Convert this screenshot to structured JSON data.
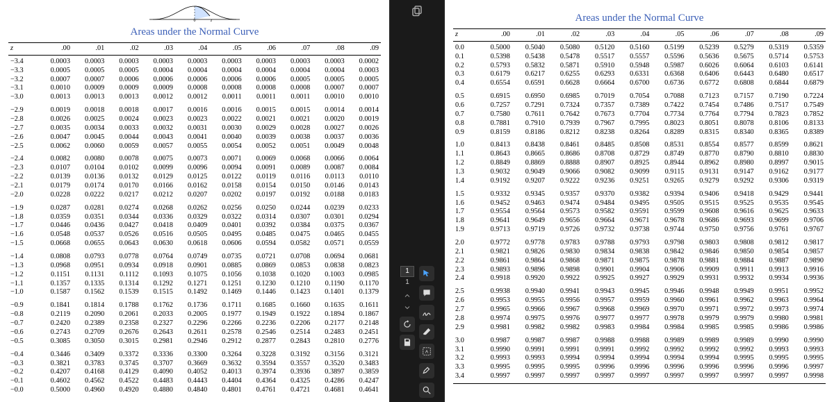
{
  "title": "Areas under the Normal Curve",
  "curve_labels": {
    "zero": "0",
    "z": "z"
  },
  "col_headers": [
    "z",
    ".00",
    ".01",
    ".02",
    ".03",
    ".04",
    ".05",
    ".06",
    ".07",
    ".08",
    ".09"
  ],
  "toolbar": {
    "page_current": "1",
    "page_total": "1"
  },
  "left_table": [
    [
      [
        "−3.4",
        "0.0003",
        "0.0003",
        "0.0003",
        "0.0003",
        "0.0003",
        "0.0003",
        "0.0003",
        "0.0003",
        "0.0003",
        "0.0002"
      ],
      [
        "−3.3",
        "0.0005",
        "0.0005",
        "0.0005",
        "0.0004",
        "0.0004",
        "0.0004",
        "0.0004",
        "0.0004",
        "0.0004",
        "0.0003"
      ],
      [
        "−3.2",
        "0.0007",
        "0.0007",
        "0.0006",
        "0.0006",
        "0.0006",
        "0.0006",
        "0.0006",
        "0.0005",
        "0.0005",
        "0.0005"
      ],
      [
        "−3.1",
        "0.0010",
        "0.0009",
        "0.0009",
        "0.0009",
        "0.0008",
        "0.0008",
        "0.0008",
        "0.0008",
        "0.0007",
        "0.0007"
      ],
      [
        "−3.0",
        "0.0013",
        "0.0013",
        "0.0013",
        "0.0012",
        "0.0012",
        "0.0011",
        "0.0011",
        "0.0011",
        "0.0010",
        "0.0010"
      ]
    ],
    [
      [
        "−2.9",
        "0.0019",
        "0.0018",
        "0.0018",
        "0.0017",
        "0.0016",
        "0.0016",
        "0.0015",
        "0.0015",
        "0.0014",
        "0.0014"
      ],
      [
        "−2.8",
        "0.0026",
        "0.0025",
        "0.0024",
        "0.0023",
        "0.0023",
        "0.0022",
        "0.0021",
        "0.0021",
        "0.0020",
        "0.0019"
      ],
      [
        "−2.7",
        "0.0035",
        "0.0034",
        "0.0033",
        "0.0032",
        "0.0031",
        "0.0030",
        "0.0029",
        "0.0028",
        "0.0027",
        "0.0026"
      ],
      [
        "−2.6",
        "0.0047",
        "0.0045",
        "0.0044",
        "0.0043",
        "0.0041",
        "0.0040",
        "0.0039",
        "0.0038",
        "0.0037",
        "0.0036"
      ],
      [
        "−2.5",
        "0.0062",
        "0.0060",
        "0.0059",
        "0.0057",
        "0.0055",
        "0.0054",
        "0.0052",
        "0.0051",
        "0.0049",
        "0.0048"
      ]
    ],
    [
      [
        "−2.4",
        "0.0082",
        "0.0080",
        "0.0078",
        "0.0075",
        "0.0073",
        "0.0071",
        "0.0069",
        "0.0068",
        "0.0066",
        "0.0064"
      ],
      [
        "−2.3",
        "0.0107",
        "0.0104",
        "0.0102",
        "0.0099",
        "0.0096",
        "0.0094",
        "0.0091",
        "0.0089",
        "0.0087",
        "0.0084"
      ],
      [
        "−2.2",
        "0.0139",
        "0.0136",
        "0.0132",
        "0.0129",
        "0.0125",
        "0.0122",
        "0.0119",
        "0.0116",
        "0.0113",
        "0.0110"
      ],
      [
        "−2.1",
        "0.0179",
        "0.0174",
        "0.0170",
        "0.0166",
        "0.0162",
        "0.0158",
        "0.0154",
        "0.0150",
        "0.0146",
        "0.0143"
      ],
      [
        "−2.0",
        "0.0228",
        "0.0222",
        "0.0217",
        "0.0212",
        "0.0207",
        "0.0202",
        "0.0197",
        "0.0192",
        "0.0188",
        "0.0183"
      ]
    ],
    [
      [
        "−1.9",
        "0.0287",
        "0.0281",
        "0.0274",
        "0.0268",
        "0.0262",
        "0.0256",
        "0.0250",
        "0.0244",
        "0.0239",
        "0.0233"
      ],
      [
        "−1.8",
        "0.0359",
        "0.0351",
        "0.0344",
        "0.0336",
        "0.0329",
        "0.0322",
        "0.0314",
        "0.0307",
        "0.0301",
        "0.0294"
      ],
      [
        "−1.7",
        "0.0446",
        "0.0436",
        "0.0427",
        "0.0418",
        "0.0409",
        "0.0401",
        "0.0392",
        "0.0384",
        "0.0375",
        "0.0367"
      ],
      [
        "−1.6",
        "0.0548",
        "0.0537",
        "0.0526",
        "0.0516",
        "0.0505",
        "0.0495",
        "0.0485",
        "0.0475",
        "0.0465",
        "0.0455"
      ],
      [
        "−1.5",
        "0.0668",
        "0.0655",
        "0.0643",
        "0.0630",
        "0.0618",
        "0.0606",
        "0.0594",
        "0.0582",
        "0.0571",
        "0.0559"
      ]
    ],
    [
      [
        "−1.4",
        "0.0808",
        "0.0793",
        "0.0778",
        "0.0764",
        "0.0749",
        "0.0735",
        "0.0721",
        "0.0708",
        "0.0694",
        "0.0681"
      ],
      [
        "−1.3",
        "0.0968",
        "0.0951",
        "0.0934",
        "0.0918",
        "0.0901",
        "0.0885",
        "0.0869",
        "0.0853",
        "0.0838",
        "0.0823"
      ],
      [
        "−1.2",
        "0.1151",
        "0.1131",
        "0.1112",
        "0.1093",
        "0.1075",
        "0.1056",
        "0.1038",
        "0.1020",
        "0.1003",
        "0.0985"
      ],
      [
        "−1.1",
        "0.1357",
        "0.1335",
        "0.1314",
        "0.1292",
        "0.1271",
        "0.1251",
        "0.1230",
        "0.1210",
        "0.1190",
        "0.1170"
      ],
      [
        "−1.0",
        "0.1587",
        "0.1562",
        "0.1539",
        "0.1515",
        "0.1492",
        "0.1469",
        "0.1446",
        "0.1423",
        "0.1401",
        "0.1379"
      ]
    ],
    [
      [
        "−0.9",
        "0.1841",
        "0.1814",
        "0.1788",
        "0.1762",
        "0.1736",
        "0.1711",
        "0.1685",
        "0.1660",
        "0.1635",
        "0.1611"
      ],
      [
        "−0.8",
        "0.2119",
        "0.2090",
        "0.2061",
        "0.2033",
        "0.2005",
        "0.1977",
        "0.1949",
        "0.1922",
        "0.1894",
        "0.1867"
      ],
      [
        "−0.7",
        "0.2420",
        "0.2389",
        "0.2358",
        "0.2327",
        "0.2296",
        "0.2266",
        "0.2236",
        "0.2206",
        "0.2177",
        "0.2148"
      ],
      [
        "−0.6",
        "0.2743",
        "0.2709",
        "0.2676",
        "0.2643",
        "0.2611",
        "0.2578",
        "0.2546",
        "0.2514",
        "0.2483",
        "0.2451"
      ],
      [
        "−0.5",
        "0.3085",
        "0.3050",
        "0.3015",
        "0.2981",
        "0.2946",
        "0.2912",
        "0.2877",
        "0.2843",
        "0.2810",
        "0.2776"
      ]
    ],
    [
      [
        "−0.4",
        "0.3446",
        "0.3409",
        "0.3372",
        "0.3336",
        "0.3300",
        "0.3264",
        "0.3228",
        "0.3192",
        "0.3156",
        "0.3121"
      ],
      [
        "−0.3",
        "0.3821",
        "0.3783",
        "0.3745",
        "0.3707",
        "0.3669",
        "0.3632",
        "0.3594",
        "0.3557",
        "0.3520",
        "0.3483"
      ],
      [
        "−0.2",
        "0.4207",
        "0.4168",
        "0.4129",
        "0.4090",
        "0.4052",
        "0.4013",
        "0.3974",
        "0.3936",
        "0.3897",
        "0.3859"
      ],
      [
        "−0.1",
        "0.4602",
        "0.4562",
        "0.4522",
        "0.4483",
        "0.4443",
        "0.4404",
        "0.4364",
        "0.4325",
        "0.4286",
        "0.4247"
      ],
      [
        "−0.0",
        "0.5000",
        "0.4960",
        "0.4920",
        "0.4880",
        "0.4840",
        "0.4801",
        "0.4761",
        "0.4721",
        "0.4681",
        "0.4641"
      ]
    ]
  ],
  "right_table": [
    [
      [
        "0.0",
        "0.5000",
        "0.5040",
        "0.5080",
        "0.5120",
        "0.5160",
        "0.5199",
        "0.5239",
        "0.5279",
        "0.5319",
        "0.5359"
      ],
      [
        "0.1",
        "0.5398",
        "0.5438",
        "0.5478",
        "0.5517",
        "0.5557",
        "0.5596",
        "0.5636",
        "0.5675",
        "0.5714",
        "0.5753"
      ],
      [
        "0.2",
        "0.5793",
        "0.5832",
        "0.5871",
        "0.5910",
        "0.5948",
        "0.5987",
        "0.6026",
        "0.6064",
        "0.6103",
        "0.6141"
      ],
      [
        "0.3",
        "0.6179",
        "0.6217",
        "0.6255",
        "0.6293",
        "0.6331",
        "0.6368",
        "0.6406",
        "0.6443",
        "0.6480",
        "0.6517"
      ],
      [
        "0.4",
        "0.6554",
        "0.6591",
        "0.6628",
        "0.6664",
        "0.6700",
        "0.6736",
        "0.6772",
        "0.6808",
        "0.6844",
        "0.6879"
      ]
    ],
    [
      [
        "0.5",
        "0.6915",
        "0.6950",
        "0.6985",
        "0.7019",
        "0.7054",
        "0.7088",
        "0.7123",
        "0.7157",
        "0.7190",
        "0.7224"
      ],
      [
        "0.6",
        "0.7257",
        "0.7291",
        "0.7324",
        "0.7357",
        "0.7389",
        "0.7422",
        "0.7454",
        "0.7486",
        "0.7517",
        "0.7549"
      ],
      [
        "0.7",
        "0.7580",
        "0.7611",
        "0.7642",
        "0.7673",
        "0.7704",
        "0.7734",
        "0.7764",
        "0.7794",
        "0.7823",
        "0.7852"
      ],
      [
        "0.8",
        "0.7881",
        "0.7910",
        "0.7939",
        "0.7967",
        "0.7995",
        "0.8023",
        "0.8051",
        "0.8078",
        "0.8106",
        "0.8133"
      ],
      [
        "0.9",
        "0.8159",
        "0.8186",
        "0.8212",
        "0.8238",
        "0.8264",
        "0.8289",
        "0.8315",
        "0.8340",
        "0.8365",
        "0.8389"
      ]
    ],
    [
      [
        "1.0",
        "0.8413",
        "0.8438",
        "0.8461",
        "0.8485",
        "0.8508",
        "0.8531",
        "0.8554",
        "0.8577",
        "0.8599",
        "0.8621"
      ],
      [
        "1.1",
        "0.8643",
        "0.8665",
        "0.8686",
        "0.8708",
        "0.8729",
        "0.8749",
        "0.8770",
        "0.8790",
        "0.8810",
        "0.8830"
      ],
      [
        "1.2",
        "0.8849",
        "0.8869",
        "0.8888",
        "0.8907",
        "0.8925",
        "0.8944",
        "0.8962",
        "0.8980",
        "0.8997",
        "0.9015"
      ],
      [
        "1.3",
        "0.9032",
        "0.9049",
        "0.9066",
        "0.9082",
        "0.9099",
        "0.9115",
        "0.9131",
        "0.9147",
        "0.9162",
        "0.9177"
      ],
      [
        "1.4",
        "0.9192",
        "0.9207",
        "0.9222",
        "0.9236",
        "0.9251",
        "0.9265",
        "0.9279",
        "0.9292",
        "0.9306",
        "0.9319"
      ]
    ],
    [
      [
        "1.5",
        "0.9332",
        "0.9345",
        "0.9357",
        "0.9370",
        "0.9382",
        "0.9394",
        "0.9406",
        "0.9418",
        "0.9429",
        "0.9441"
      ],
      [
        "1.6",
        "0.9452",
        "0.9463",
        "0.9474",
        "0.9484",
        "0.9495",
        "0.9505",
        "0.9515",
        "0.9525",
        "0.9535",
        "0.9545"
      ],
      [
        "1.7",
        "0.9554",
        "0.9564",
        "0.9573",
        "0.9582",
        "0.9591",
        "0.9599",
        "0.9608",
        "0.9616",
        "0.9625",
        "0.9633"
      ],
      [
        "1.8",
        "0.9641",
        "0.9649",
        "0.9656",
        "0.9664",
        "0.9671",
        "0.9678",
        "0.9686",
        "0.9693",
        "0.9699",
        "0.9706"
      ],
      [
        "1.9",
        "0.9713",
        "0.9719",
        "0.9726",
        "0.9732",
        "0.9738",
        "0.9744",
        "0.9750",
        "0.9756",
        "0.9761",
        "0.9767"
      ]
    ],
    [
      [
        "2.0",
        "0.9772",
        "0.9778",
        "0.9783",
        "0.9788",
        "0.9793",
        "0.9798",
        "0.9803",
        "0.9808",
        "0.9812",
        "0.9817"
      ],
      [
        "2.1",
        "0.9821",
        "0.9826",
        "0.9830",
        "0.9834",
        "0.9838",
        "0.9842",
        "0.9846",
        "0.9850",
        "0.9854",
        "0.9857"
      ],
      [
        "2.2",
        "0.9861",
        "0.9864",
        "0.9868",
        "0.9871",
        "0.9875",
        "0.9878",
        "0.9881",
        "0.9884",
        "0.9887",
        "0.9890"
      ],
      [
        "2.3",
        "0.9893",
        "0.9896",
        "0.9898",
        "0.9901",
        "0.9904",
        "0.9906",
        "0.9909",
        "0.9911",
        "0.9913",
        "0.9916"
      ],
      [
        "2.4",
        "0.9918",
        "0.9920",
        "0.9922",
        "0.9925",
        "0.9927",
        "0.9929",
        "0.9931",
        "0.9932",
        "0.9934",
        "0.9936"
      ]
    ],
    [
      [
        "2.5",
        "0.9938",
        "0.9940",
        "0.9941",
        "0.9943",
        "0.9945",
        "0.9946",
        "0.9948",
        "0.9949",
        "0.9951",
        "0.9952"
      ],
      [
        "2.6",
        "0.9953",
        "0.9955",
        "0.9956",
        "0.9957",
        "0.9959",
        "0.9960",
        "0.9961",
        "0.9962",
        "0.9963",
        "0.9964"
      ],
      [
        "2.7",
        "0.9965",
        "0.9966",
        "0.9967",
        "0.9968",
        "0.9969",
        "0.9970",
        "0.9971",
        "0.9972",
        "0.9973",
        "0.9974"
      ],
      [
        "2.8",
        "0.9974",
        "0.9975",
        "0.9976",
        "0.9977",
        "0.9977",
        "0.9978",
        "0.9979",
        "0.9979",
        "0.9980",
        "0.9981"
      ],
      [
        "2.9",
        "0.9981",
        "0.9982",
        "0.9982",
        "0.9983",
        "0.9984",
        "0.9984",
        "0.9985",
        "0.9985",
        "0.9986",
        "0.9986"
      ]
    ],
    [
      [
        "3.0",
        "0.9987",
        "0.9987",
        "0.9987",
        "0.9988",
        "0.9988",
        "0.9989",
        "0.9989",
        "0.9989",
        "0.9990",
        "0.9990"
      ],
      [
        "3.1",
        "0.9990",
        "0.9991",
        "0.9991",
        "0.9991",
        "0.9992",
        "0.9992",
        "0.9992",
        "0.9992",
        "0.9993",
        "0.9993"
      ],
      [
        "3.2",
        "0.9993",
        "0.9993",
        "0.9994",
        "0.9994",
        "0.9994",
        "0.9994",
        "0.9994",
        "0.9995",
        "0.9995",
        "0.9995"
      ],
      [
        "3.3",
        "0.9995",
        "0.9995",
        "0.9995",
        "0.9996",
        "0.9996",
        "0.9996",
        "0.9996",
        "0.9996",
        "0.9996",
        "0.9997"
      ],
      [
        "3.4",
        "0.9997",
        "0.9997",
        "0.9997",
        "0.9997",
        "0.9997",
        "0.9997",
        "0.9997",
        "0.9997",
        "0.9997",
        "0.9998"
      ]
    ]
  ]
}
